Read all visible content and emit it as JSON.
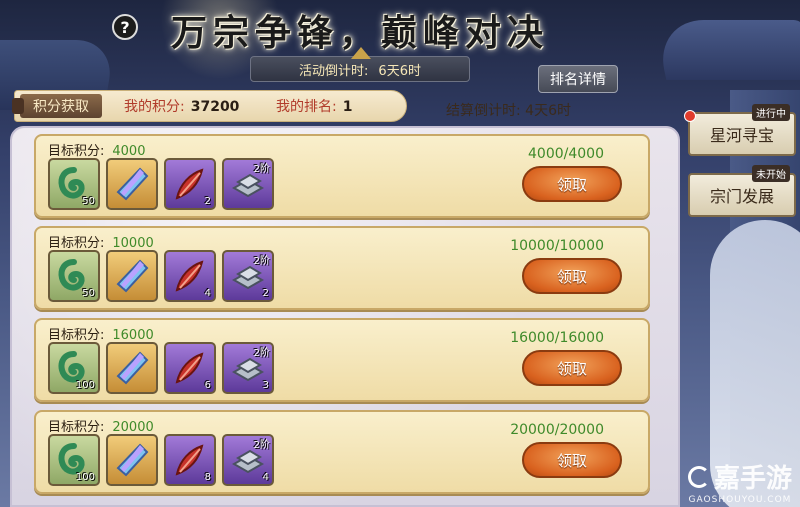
{
  "header": {
    "title": "万宗争锋，巅峰对决",
    "help_label": "?",
    "countdown_label": "活动倒计时:",
    "countdown_value": "6天6时",
    "rank_details_label": "排名详情"
  },
  "score_bar": {
    "tab_label": "积分获取",
    "my_score_label": "我的积分:",
    "my_score_value": "37200",
    "my_rank_label": "我的排名:",
    "my_rank_value": "1",
    "settle_label": "结算倒计时:",
    "settle_value": "4天6时"
  },
  "side_tabs": [
    {
      "label": "星河寻宝",
      "badge": "进行中",
      "has_dot": true
    },
    {
      "label": "宗门发展",
      "badge": "未开始",
      "has_dot": false
    }
  ],
  "rewards": [
    {
      "target_label": "目标积分:",
      "target_value": "4000",
      "progress": "4000/4000",
      "button": "领取",
      "items": [
        {
          "kind": "jade",
          "icon": "jade-icon",
          "qty": "50",
          "tier": ""
        },
        {
          "kind": "crystal",
          "icon": "crystal-icon",
          "qty": "",
          "tier": ""
        },
        {
          "kind": "feather",
          "icon": "feather-icon",
          "qty": "2",
          "tier": ""
        },
        {
          "kind": "ingot",
          "icon": "ingot-icon",
          "qty": "",
          "tier": "2阶"
        }
      ]
    },
    {
      "target_label": "目标积分:",
      "target_value": "10000",
      "progress": "10000/10000",
      "button": "领取",
      "items": [
        {
          "kind": "jade",
          "icon": "jade-icon",
          "qty": "50",
          "tier": ""
        },
        {
          "kind": "crystal",
          "icon": "crystal-icon",
          "qty": "",
          "tier": ""
        },
        {
          "kind": "feather",
          "icon": "feather-icon",
          "qty": "4",
          "tier": ""
        },
        {
          "kind": "ingot",
          "icon": "ingot-icon",
          "qty": "2",
          "tier": "2阶"
        }
      ]
    },
    {
      "target_label": "目标积分:",
      "target_value": "16000",
      "progress": "16000/16000",
      "button": "领取",
      "items": [
        {
          "kind": "jade",
          "icon": "jade-icon",
          "qty": "100",
          "tier": ""
        },
        {
          "kind": "crystal",
          "icon": "crystal-icon",
          "qty": "",
          "tier": ""
        },
        {
          "kind": "feather",
          "icon": "feather-icon",
          "qty": "6",
          "tier": ""
        },
        {
          "kind": "ingot",
          "icon": "ingot-icon",
          "qty": "3",
          "tier": "2阶"
        }
      ]
    },
    {
      "target_label": "目标积分:",
      "target_value": "20000",
      "progress": "20000/20000",
      "button": "领取",
      "items": [
        {
          "kind": "jade",
          "icon": "jade-icon",
          "qty": "100",
          "tier": ""
        },
        {
          "kind": "crystal",
          "icon": "crystal-icon",
          "qty": "",
          "tier": ""
        },
        {
          "kind": "feather",
          "icon": "feather-icon",
          "qty": "8",
          "tier": ""
        },
        {
          "kind": "ingot",
          "icon": "ingot-icon",
          "qty": "4",
          "tier": "2阶"
        }
      ]
    }
  ],
  "watermark": {
    "main": "嘉手游",
    "sub": "GAOSHOUYOU.COM"
  },
  "colors": {
    "accent_green": "#3f8a2a",
    "claim_orange": "#d9621f",
    "score_red": "#b13b2a"
  }
}
